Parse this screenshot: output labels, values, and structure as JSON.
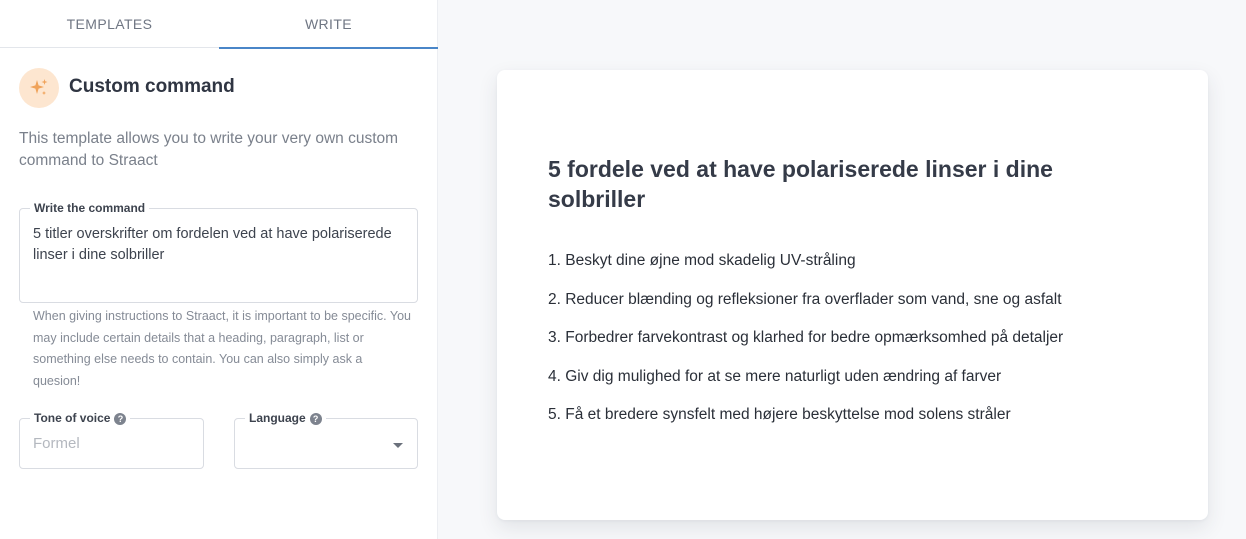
{
  "tabs": [
    {
      "label": "TEMPLATES"
    },
    {
      "label": "WRITE",
      "active": true
    }
  ],
  "template": {
    "icon": "sparkles-icon",
    "title": "Custom command",
    "description": "This template allows you to write your very own custom command to Straact"
  },
  "command_field": {
    "label": "Write the command",
    "value": "5 titler overskrifter om fordelen ved at have polariserede linser i dine solbriller"
  },
  "help_text": "When giving instructions to Straact, it is important to be specific. You may include certain details that a heading, paragraph, list or something else needs to contain. You can also simply ask a quesion!",
  "tone_field": {
    "label": "Tone of voice",
    "placeholder": "Formel",
    "value": ""
  },
  "language_field": {
    "label": "Language",
    "value": ""
  },
  "output": {
    "title": "5 fordele ved at have polariserede linser i dine solbriller",
    "items": [
      "1. Beskyt dine øjne mod skadelig UV-stråling",
      "2. Reducer blænding og refleksioner fra overflader som vand, sne og asfalt",
      "3. Forbedrer farvekontrast og klarhed for bedre opmærksomhed på detaljer",
      "4. Giv dig mulighed for at se mere naturligt uden ændring af farver",
      "5. Få et bredere synsfelt med højere beskyttelse mod solens stråler"
    ]
  },
  "colors": {
    "accent": "#4a86c8",
    "icon_bg": "#fde6d0",
    "icon_fg": "#f0a35a"
  }
}
